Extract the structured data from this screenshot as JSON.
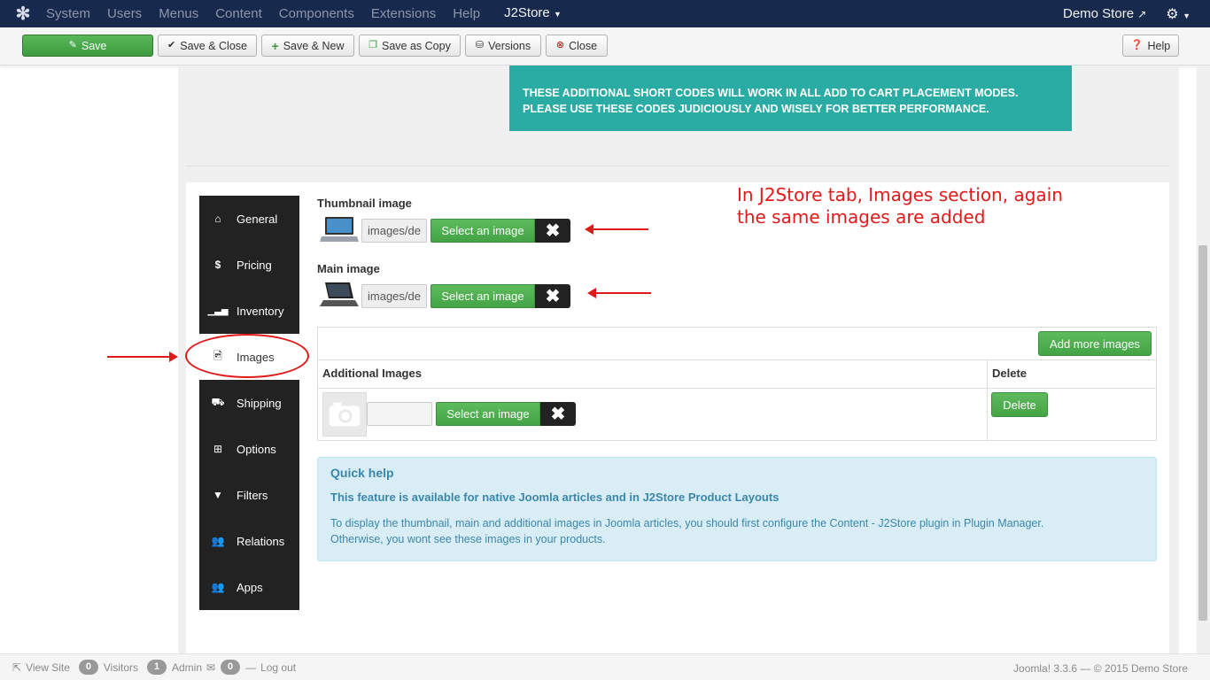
{
  "nav": {
    "items": [
      "System",
      "Users",
      "Menus",
      "Content",
      "Components",
      "Extensions",
      "Help"
    ],
    "active": "J2Store",
    "store": "Demo Store"
  },
  "toolbar": {
    "save": "Save",
    "save_close": "Save & Close",
    "save_new": "Save & New",
    "save_copy": "Save as Copy",
    "versions": "Versions",
    "close": "Close",
    "help": "Help"
  },
  "alert": {
    "line1": "THESE ADDITIONAL SHORT CODES WILL WORK IN ALL ADD TO CART PLACEMENT MODES.",
    "line2": "PLEASE USE THESE CODES JUDICIOUSLY AND WISELY FOR BETTER PERFORMANCE."
  },
  "tabs": [
    "General",
    "Pricing",
    "Inventory",
    "Images",
    "Shipping",
    "Options",
    "Filters",
    "Relations",
    "Apps"
  ],
  "active_tab": "Images",
  "images": {
    "thumbnail_label": "Thumbnail image",
    "thumbnail_path": "images/de",
    "main_label": "Main image",
    "main_path": "images/de",
    "select_label": "Select an image",
    "clear_symbol": "✖",
    "add_more": "Add more images",
    "col_additional": "Additional Images",
    "col_delete": "Delete",
    "delete_label": "Delete"
  },
  "annotation": {
    "line1": "In J2Store tab, Images section, again",
    "line2": "the same images are added"
  },
  "quick_help": {
    "title": "Quick help",
    "strong": "This feature is available for native Joomla articles and in J2Store Product Layouts",
    "text1": "To display the thumbnail, main and additional images in Joomla articles, you should first configure the Content - J2Store plugin in Plugin Manager.",
    "text2": "Otherwise, you wont see these images in your products."
  },
  "status": {
    "view_site": "View Site",
    "visitors_count": "0",
    "visitors": "Visitors",
    "admin_count": "1",
    "admin": "Admin",
    "messages_count": "0",
    "logout": "Log out",
    "version": "Joomla! 3.3.6 — © 2015 Demo Store"
  },
  "colors": {
    "navbar": "#18294e",
    "success": "#46a546",
    "teal_alert": "#2aaca4",
    "annotation_red": "#e01a1a",
    "info_bg": "#d9edf7"
  }
}
